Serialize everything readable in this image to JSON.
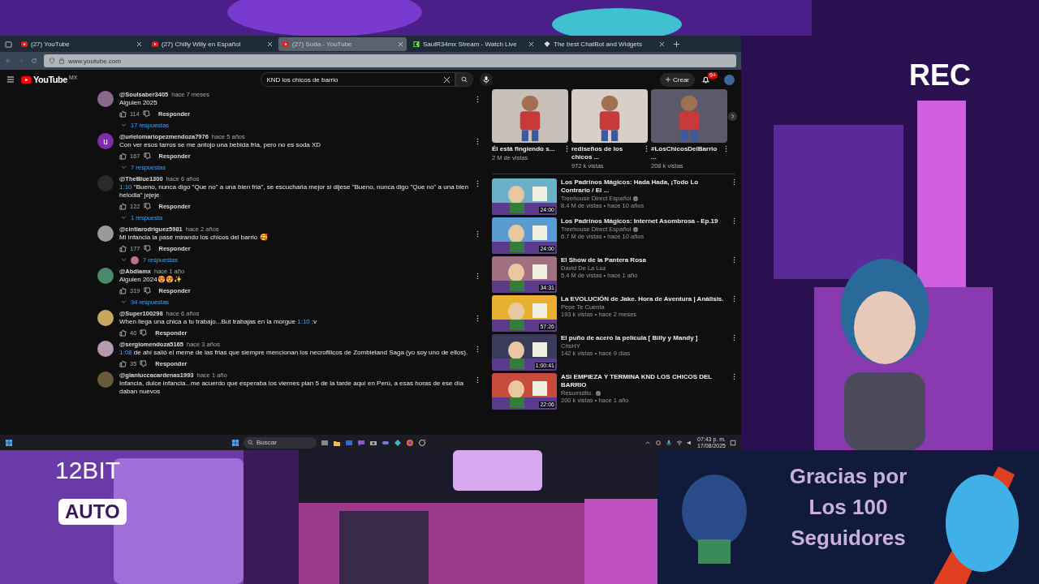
{
  "browser": {
    "tabs": [
      {
        "title": "(27) YouTube",
        "kind": "youtube",
        "selected": false
      },
      {
        "title": "(27) Chilly Willy en Español",
        "kind": "youtube",
        "selected": false
      },
      {
        "title": "(27) Soda - YouTube",
        "kind": "youtube",
        "selected": true
      },
      {
        "title": "SaulR34mx Stream - Watch Live",
        "kind": "kick",
        "selected": false
      },
      {
        "title": "The best ChatBot and Widgets",
        "kind": "diamond",
        "selected": false
      }
    ],
    "url": "www.youtube.com"
  },
  "youtube": {
    "logo": "YouTube",
    "region": "MX",
    "search": "KND los chicos de barrio",
    "create": "Crear",
    "notifications": "9+",
    "comments": [
      {
        "author": "@Soulsaber3405",
        "time": "hace 7 meses",
        "color": "#8a6a8c",
        "segments": [
          {
            "kind": "plain",
            "text": "Alguien 2025"
          }
        ],
        "likes": "114",
        "reply_label": "Responder",
        "replies": "17 respuestas",
        "reply_avatar": false
      },
      {
        "author": "@urielomariopezmendoza7976",
        "time": "hace 5 años",
        "color": "#7b2fa8",
        "letter": "u",
        "segments": [
          {
            "kind": "plain",
            "text": "Con ver esos tarros se me antojo una bebida fria, pero no es soda XD"
          }
        ],
        "likes": "167",
        "reply_label": "Responder",
        "replies": "7 respuestas",
        "reply_avatar": false
      },
      {
        "author": "@TheBlue1300",
        "time": "hace 6 años",
        "color": "#2a2a2a",
        "segments": [
          {
            "kind": "timestamp",
            "text": "1:10"
          },
          {
            "kind": "plain",
            "text": " \"Bueno, nunca digo \"Que no\" a una bien fria\", se escucharia mejor si dijese \"Bueno, nunca digo \"Que no\" a una bien helodia\" jejeje"
          }
        ],
        "likes": "122",
        "reply_label": "Responder",
        "replies": "1 respuesta",
        "reply_avatar": false
      },
      {
        "author": "@cintiarodriguez5981",
        "time": "hace 2 años",
        "color": "#9a9a9a",
        "segments": [
          {
            "kind": "plain",
            "text": "Mi infancia la pasé mirando los chicos del barrio 🥰"
          }
        ],
        "likes": "177",
        "reply_label": "Responder",
        "replies": "7 respuestas",
        "reply_avatar": true
      },
      {
        "author": "@Abdiamx",
        "time": "hace 1 año",
        "color": "#4a8a6a",
        "segments": [
          {
            "kind": "plain",
            "text": "Alguien 2024😍😍✨"
          }
        ],
        "likes": "319",
        "reply_label": "Responder",
        "replies": "34 respuestas",
        "reply_avatar": false
      },
      {
        "author": "@Super100298",
        "time": "hace 6 años",
        "color": "#c8a860",
        "segments": [
          {
            "kind": "plain",
            "text": "When llega una chica a tu trabajo...But trabajas en la morgue "
          },
          {
            "kind": "timestamp",
            "text": "1:10"
          },
          {
            "kind": "plain",
            "text": " :v"
          }
        ],
        "likes": "40",
        "reply_label": "Responder"
      },
      {
        "author": "@sergiomendoza5165",
        "time": "hace 3 años",
        "color": "#b89ab0",
        "segments": [
          {
            "kind": "timestamp",
            "text": "1:08"
          },
          {
            "kind": "plain",
            "text": " de ahí salió el meme de las frias que siempre mencionan los necrofilicos de Zombieland Saga (yo soy uno de ellos)."
          }
        ],
        "likes": "35",
        "reply_label": "Responder"
      },
      {
        "author": "@gianluccacardenas1993",
        "time": "hace 1 año",
        "color": "#6a5a3a",
        "segments": [
          {
            "kind": "plain",
            "text": "Infancia, dulce infancia...me acuerdo que esperaba los viernes plan 5 de la tarde aquí en Perú, a esas horas de ese día daban nuevos"
          }
        ]
      }
    ],
    "shorts": [
      {
        "title": "Él está fingiendo s...",
        "views": "2 M de vistas"
      },
      {
        "title": "rediseños de los chicos ...",
        "views": "972 k vistas"
      },
      {
        "title": "#LosChicosDelBarrio ...",
        "views": "208 k vistas"
      }
    ],
    "videos": [
      {
        "title": "Los Padrinos Mágicos: Hada Hada, ¡Todo Lo Contrario / El ...",
        "channel": "Treehouse Direct Español",
        "verified": true,
        "meta": "8.4 M de vistas • hace 10 años",
        "duration": "24:00"
      },
      {
        "title": "Los Padrinos Mágicos: Internet Asombrosa - Ep.19",
        "channel": "Treehouse Direct Español",
        "verified": true,
        "meta": "6.7 M de vistas • hace 10 años",
        "duration": "24:00"
      },
      {
        "title": "El Show de la Pantera Rosa",
        "channel": "David De La Luz",
        "verified": false,
        "meta": "5.4 M de vistas • hace 1 año",
        "duration": "34:31"
      },
      {
        "title": "La EVOLUCIÓN de Jake. Hora de Aventura | Análisis.",
        "channel": "Pepe Te Cuenta",
        "verified": false,
        "meta": "193 k vistas • hace 2 meses",
        "duration": "57:26"
      },
      {
        "title": "El puño de acero la película [ Billy y Mandy ]",
        "channel": "CrisHY",
        "verified": false,
        "meta": "142 k vistas • hace 9 días",
        "duration": "1:00:41"
      },
      {
        "title": "ASI EMPIEZA Y TERMINA KND LOS CHICOS DEL BARRIO",
        "channel": "Resumidito.",
        "verified": true,
        "meta": "200 k vistas • hace 1 año",
        "duration": "22:06"
      }
    ]
  },
  "taskbar": {
    "search": "Buscar",
    "time": "07:43 p. m.",
    "date": "17/08/2025"
  },
  "overlay": {
    "rec": "REC",
    "bits": "12BIT",
    "mode": "AUTO",
    "thanks": [
      "Gracias por",
      "Los 100",
      "Seguidores"
    ]
  }
}
